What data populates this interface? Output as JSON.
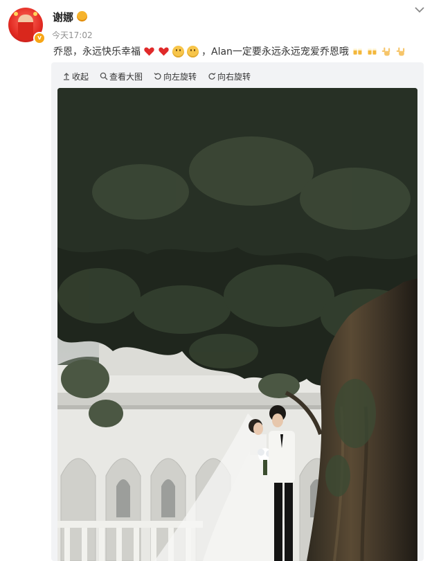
{
  "user": {
    "name": "谢娜",
    "badge_icon": "gold-medal-icon",
    "verified_icon": "verified-v-icon",
    "avatar_icon": "avatar-photo"
  },
  "post": {
    "timestamp": "今天17:02",
    "text_1": "乔恩，永远快乐幸福",
    "text_2": "，Alan一定要永远永远宠爱乔恩哦",
    "emoji": [
      "heart-icon",
      "heart-icon",
      "smile-icon",
      "smile-icon",
      "cheers-icon",
      "cheers-icon",
      "love-hand-icon",
      "love-hand-icon"
    ]
  },
  "toolbar": {
    "collapse_label": "收起",
    "view_large_label": "查看大图",
    "rotate_left_label": "向左旋转",
    "rotate_right_label": "向右旋转"
  },
  "image": {
    "description_icon": "wedding-photo"
  },
  "colors": {
    "accent": "#f7a616",
    "text": "#333333",
    "muted": "#909090",
    "panel": "#f2f3f5",
    "heart": "#e02a2a"
  }
}
